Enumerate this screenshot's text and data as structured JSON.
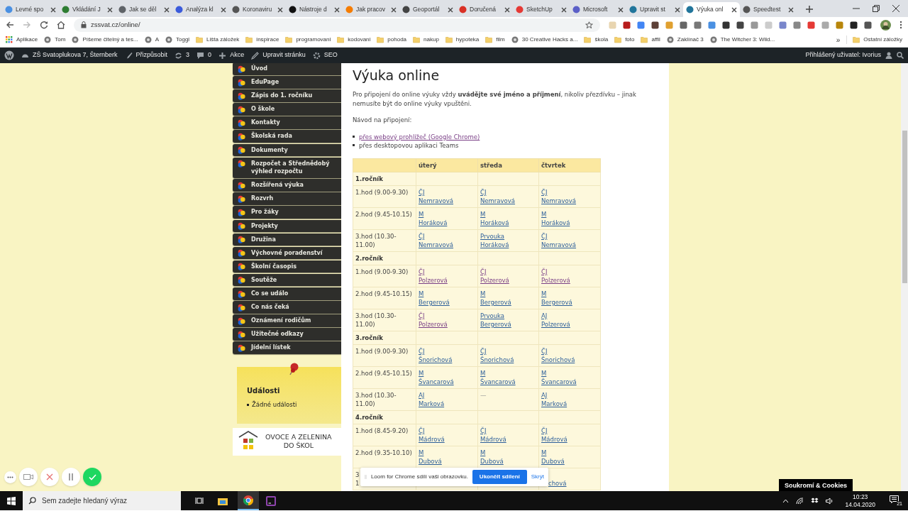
{
  "browser": {
    "tabs": [
      {
        "title": "Levné spo",
        "selected": false
      },
      {
        "title": "Vkládání J",
        "selected": false
      },
      {
        "title": "Jak se děl",
        "selected": false
      },
      {
        "title": "Analýza kl",
        "selected": false
      },
      {
        "title": "Koronaviru",
        "selected": false
      },
      {
        "title": "Nástroje d",
        "selected": false
      },
      {
        "title": "Jak pracov",
        "selected": false
      },
      {
        "title": "Geoportál",
        "selected": false
      },
      {
        "title": "Doručená",
        "selected": false
      },
      {
        "title": "SketchUp",
        "selected": false
      },
      {
        "title": "Microsoft",
        "selected": false
      },
      {
        "title": "Upravit st",
        "selected": false
      },
      {
        "title": "Výuka onl",
        "selected": true
      },
      {
        "title": "Speedtest",
        "selected": false
      }
    ],
    "address": "zssvat.cz/online/",
    "bookmarks": [
      {
        "kind": "apps",
        "label": "Aplikace"
      },
      {
        "kind": "site",
        "label": "Tom"
      },
      {
        "kind": "site",
        "label": "Píšeme čitelný a tes..."
      },
      {
        "kind": "site",
        "label": "A"
      },
      {
        "kind": "site",
        "label": "Toggl"
      },
      {
        "kind": "folder",
        "label": "Lišta záložek"
      },
      {
        "kind": "folder",
        "label": "inspirace"
      },
      {
        "kind": "folder",
        "label": "programovani"
      },
      {
        "kind": "folder",
        "label": "kodovani"
      },
      {
        "kind": "folder",
        "label": "pohoda"
      },
      {
        "kind": "folder",
        "label": "nakup"
      },
      {
        "kind": "folder",
        "label": "hypoteka"
      },
      {
        "kind": "folder",
        "label": "film"
      },
      {
        "kind": "site",
        "label": "30 Creative Hacks a..."
      },
      {
        "kind": "folder",
        "label": "škola"
      },
      {
        "kind": "folder",
        "label": "foto"
      },
      {
        "kind": "folder",
        "label": "affil"
      },
      {
        "kind": "site",
        "label": "Zaklínač 3"
      },
      {
        "kind": "site",
        "label": "The Witcher 3: Wild..."
      }
    ],
    "more": "»",
    "other_bookmarks": "Ostatní záložky"
  },
  "admin_bar": {
    "site": "ZŠ Svatoplukova 7, Šternberk",
    "customize": "Přizpůsobit",
    "updates": "3",
    "comments": "0",
    "new": "Akce",
    "edit": "Upravit stránku",
    "seo": "SEO",
    "user": "Přihlášený uživatel: Ivorius"
  },
  "sidebar": {
    "menu": [
      "Úvod",
      "EduPage",
      "Zápis do 1. ročníku",
      "O škole",
      "Kontakty",
      "Školská rada",
      "Dokumenty",
      "Rozpočet a Střednědobý výhled rozpočtu",
      "Rozšířená výuka",
      "Rozvrh",
      "Pro žáky",
      "Projekty",
      "Družina",
      "Výchovné poradenství",
      "Školní časopis",
      "Soutěže",
      "Co se událo",
      "Co nás čeká",
      "Oznámení rodičům",
      "Užitečné odkazy",
      "Jídelní lístek"
    ],
    "events": {
      "title": "Události",
      "items": [
        "Žádné události"
      ]
    },
    "banner": [
      "OVOCE A ZELENINA",
      "DO ŠKOL"
    ]
  },
  "content": {
    "title": "Výuka online",
    "intro": "Pro připojení do online výuky vždy **uvádějte své jméno a příjmení**, nikoliv přezdívku – jinak nemusíte být do online výuky vpuštěni.",
    "guide": "Návod na připojení:",
    "options": [
      {
        "text": "přes webový prohlížeč (Google Chrome)",
        "link": true
      },
      {
        "text": "přes desktopovou aplikaci Teams",
        "link": false
      }
    ],
    "table": {
      "columns": [
        "úterý",
        "středa",
        "čtvrtek"
      ],
      "rows": [
        {
          "kind": "section",
          "label": "1.ročník"
        },
        {
          "kind": "lesson",
          "time": "1.hod (9.00-9.30)",
          "cells": [
            {
              "subject": "ČJ",
              "teacher": "Nemravová",
              "visited": false
            },
            {
              "subject": "ČJ",
              "teacher": "Nemravová",
              "visited": false
            },
            {
              "subject": "ČJ",
              "teacher": "Nemravová",
              "visited": false
            }
          ]
        },
        {
          "kind": "lesson",
          "time": "2.hod (9.45-10.15)",
          "cells": [
            {
              "subject": "M",
              "teacher": "Horáková",
              "visited": false
            },
            {
              "subject": "M",
              "teacher": "Horáková",
              "visited": false
            },
            {
              "subject": "M",
              "teacher": "Horáková",
              "visited": false
            }
          ]
        },
        {
          "kind": "lesson",
          "time": "3.hod (10.30-11.00)",
          "cells": [
            {
              "subject": "ČJ",
              "teacher": "Nemravová",
              "visited": false
            },
            {
              "subject": "Prvouka",
              "teacher": "Horáková",
              "visited": false
            },
            {
              "subject": "ČJ",
              "teacher": "Nemravová",
              "visited": false
            }
          ]
        },
        {
          "kind": "section",
          "label": "2.ročník"
        },
        {
          "kind": "lesson",
          "time": "1.hod (9.00-9.30)",
          "cells": [
            {
              "subject": "ČJ",
              "teacher": "Polzerová",
              "visited": true
            },
            {
              "subject": "ČJ",
              "teacher": "Polzerová",
              "visited": true
            },
            {
              "subject": "ČJ",
              "teacher": "Polzerová",
              "visited": true
            }
          ]
        },
        {
          "kind": "lesson",
          "time": "2.hod (9.45-10.15)",
          "cells": [
            {
              "subject": "M",
              "teacher": "Bergerová",
              "visited": false
            },
            {
              "subject": "M",
              "teacher": "Bergerová",
              "visited": false
            },
            {
              "subject": "M",
              "teacher": "Bergerová",
              "visited": false
            }
          ]
        },
        {
          "kind": "lesson",
          "time": "3.hod (10.30-11.00)",
          "cells": [
            {
              "subject": "ČJ",
              "teacher": "Polzerová",
              "visited": true
            },
            {
              "subject": "Prvouka",
              "teacher": "Bergerová",
              "visited": false
            },
            {
              "subject": "AJ",
              "teacher": "Polzerová",
              "visited": false
            }
          ]
        },
        {
          "kind": "section",
          "label": "3.ročník"
        },
        {
          "kind": "lesson",
          "time": "1.hod (9.00-9.30)",
          "cells": [
            {
              "subject": "ČJ",
              "teacher": "Šnorichová",
              "visited": false
            },
            {
              "subject": "ČJ",
              "teacher": "Šnorichová",
              "visited": false
            },
            {
              "subject": "ČJ",
              "teacher": "Šnorichová",
              "visited": false
            }
          ]
        },
        {
          "kind": "lesson",
          "time": "2.hod (9.45-10.15)",
          "cells": [
            {
              "subject": "M",
              "teacher": "Švancarová",
              "visited": false
            },
            {
              "subject": "M",
              "teacher": "Švancarová",
              "visited": false
            },
            {
              "subject": "M",
              "teacher": "Švancarová",
              "visited": false
            }
          ]
        },
        {
          "kind": "lesson",
          "time": "3.hod (10.30-11.00)",
          "cells": [
            {
              "subject": "AJ",
              "teacher": "Marková",
              "visited": false
            },
            {
              "text": "—"
            },
            {
              "subject": "AJ",
              "teacher": "Marková",
              "visited": false
            }
          ]
        },
        {
          "kind": "section",
          "label": "4.ročník"
        },
        {
          "kind": "lesson",
          "time": "1.hod (8.45-9.20)",
          "cells": [
            {
              "subject": "ČJ",
              "teacher": "Mádrová",
              "visited": false
            },
            {
              "subject": "ČJ",
              "teacher": "Mádrová",
              "visited": false
            },
            {
              "subject": "ČJ",
              "teacher": "Mádrová",
              "visited": false
            }
          ]
        },
        {
          "kind": "lesson",
          "time": "2.hod (9.35-10.10)",
          "cells": [
            {
              "subject": "M",
              "teacher": "Dubová",
              "visited": false
            },
            {
              "subject": "M",
              "teacher": "Dubová",
              "visited": false
            },
            {
              "subject": "M",
              "teacher": "Dubová",
              "visited": false
            }
          ]
        },
        {
          "kind": "partial",
          "lead": [
            "3",
            "1"
          ],
          "tail": "chová"
        }
      ]
    }
  },
  "loom": {
    "message": "Loom for Chrome sdílí vaši obrazovku.",
    "stop": "Ukončit sdílení",
    "hide": "Skrýt"
  },
  "privacy_badge": "Soukromí & Cookies",
  "taskbar": {
    "search_placeholder": "Sem zadejte hledaný výraz",
    "time": "10:23",
    "date": "14.04.2020",
    "notifications": "21"
  }
}
